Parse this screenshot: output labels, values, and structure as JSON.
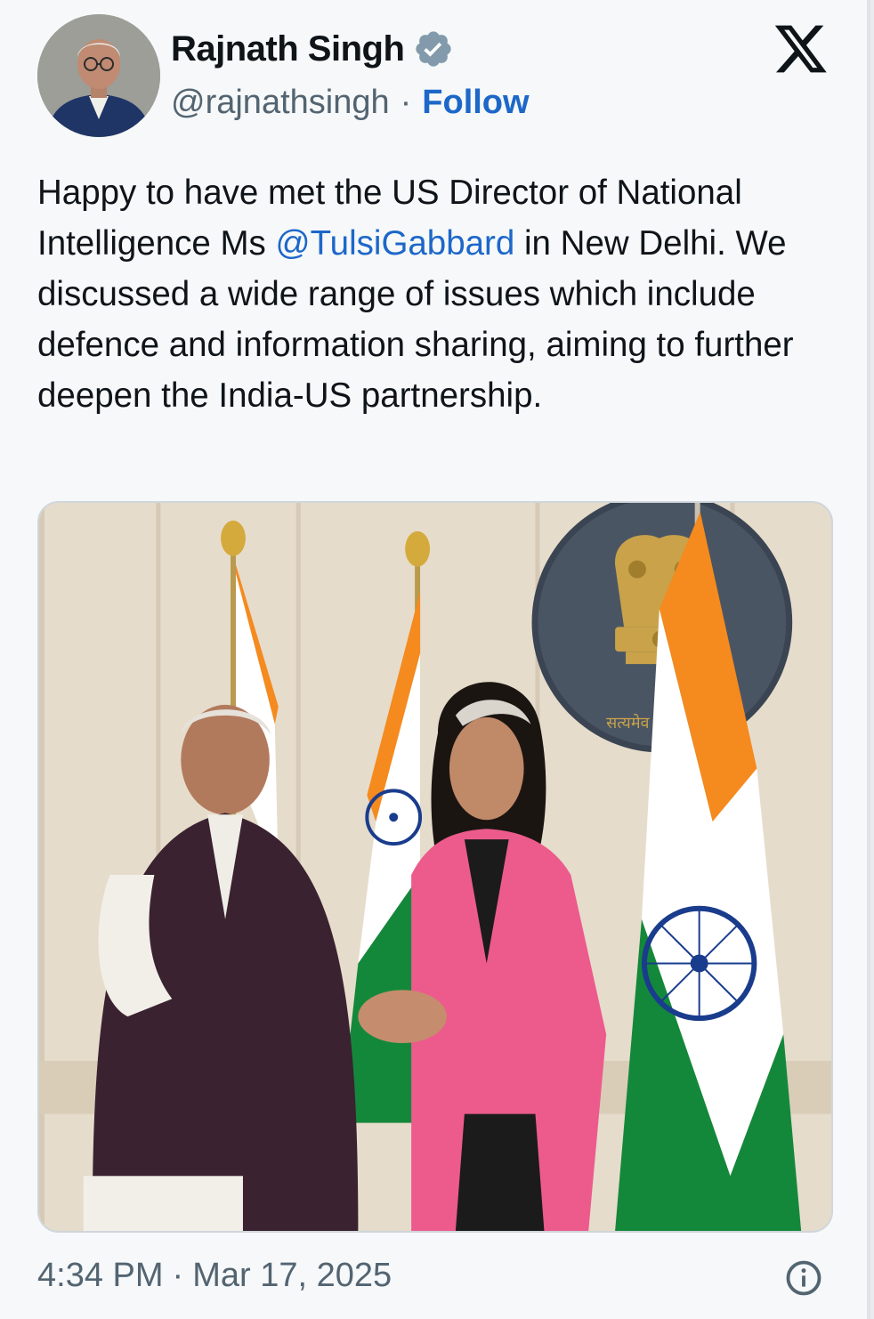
{
  "author": {
    "display_name": "Rajnath Singh",
    "handle": "@rajnathsingh",
    "separator": "·",
    "follow_label": "Follow",
    "verified_icon": "verified-badge-icon"
  },
  "brand": {
    "logo_icon": "x-logo-icon"
  },
  "tweet": {
    "text_before": "Happy to have met the US Director of National Intelligence Ms ",
    "mention": "@TulsiGabbard",
    "text_after": " in New Delhi. We discussed a wide range of issues which include defence and information sharing, aiming to further deepen the India-US partnership."
  },
  "media": {
    "alt": "Rajnath Singh shaking hands with Tulsi Gabbard in front of Indian flags and the national emblem",
    "emblem_text": "सत्यमेव"
  },
  "footer": {
    "time": "4:34 PM",
    "separator": "·",
    "date": "Mar 17, 2025",
    "info_icon": "info-icon"
  },
  "colors": {
    "link": "#1d67c9",
    "text": "#0f1419",
    "muted": "#536471",
    "verified_badge": "#829aab"
  }
}
